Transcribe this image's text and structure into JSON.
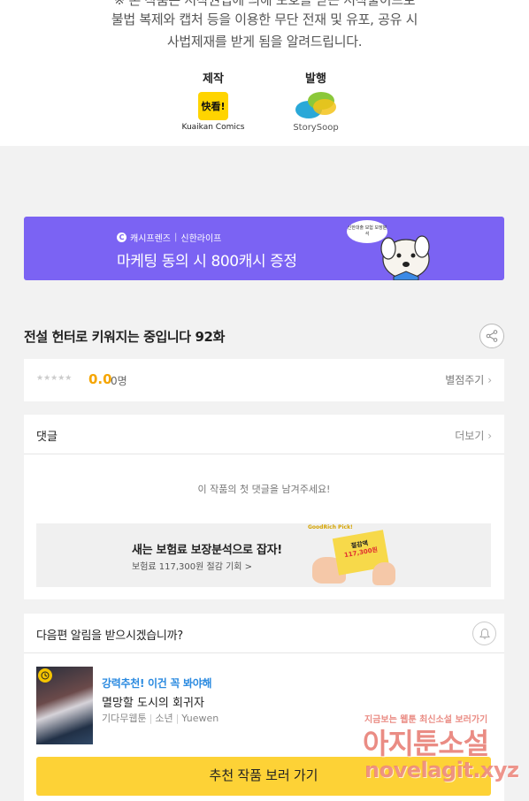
{
  "notice": {
    "line1": "※ 본 작품은 저작권법에 의해 보호를 받는 저작물이므로",
    "line2": "불법 복제와 캡처 등을 이용한 무단 전재 및 유포, 공유 시",
    "line3": "사법제재를 받게 됨을 알려드립니다."
  },
  "credits": {
    "production_label": "제작",
    "production_logo_text": "快看!",
    "production_name": "Kuaikan Comics",
    "publisher_label": "발행",
    "publisher_name": "StorySoop"
  },
  "banner": {
    "brand": "캐시프렌즈",
    "partner": "신한라이프",
    "main_text": "마케팅 동의 시 800캐시 증정",
    "bubble_text": "신한대출 보험 보장분석",
    "bg_color": "#7b63f3"
  },
  "episode": {
    "title": "전설 헌터로 키워지는 중입니다 92화",
    "share_icon": "share-icon"
  },
  "rating": {
    "stars": "★★★★★",
    "score": "0.0",
    "count": "0명",
    "rate_link": "별점주기"
  },
  "comments": {
    "title": "댓글",
    "more_link": "더보기",
    "empty_text": "이 작품의 첫 댓글을 남겨주세요!"
  },
  "ad": {
    "brand": "GoodRich Pick!",
    "title": "새는 보험료 보장분석으로 잡자!",
    "subtitle": "보험료 117,300원 절감 기회 >",
    "card_top": "절감액",
    "card_amount": "117,300원"
  },
  "next_episode": {
    "title": "다음편 알림을 받으시겠습니까?",
    "bell_icon": "bell-icon"
  },
  "recommendation": {
    "tag": "강력추천! 이건 꼭 봐야해",
    "title": "멸망할 도시의 회귀자",
    "genre": "기다무웹툰",
    "category": "소년",
    "author": "Yuewen",
    "cta_label": "추천 작품 보러 가기",
    "accent_color": "#fdd236"
  },
  "watermark": {
    "small": "지금보는 웹툰 최신소설 보러가기",
    "big": "아지툰소설",
    "url": "novelagit.xyz"
  }
}
